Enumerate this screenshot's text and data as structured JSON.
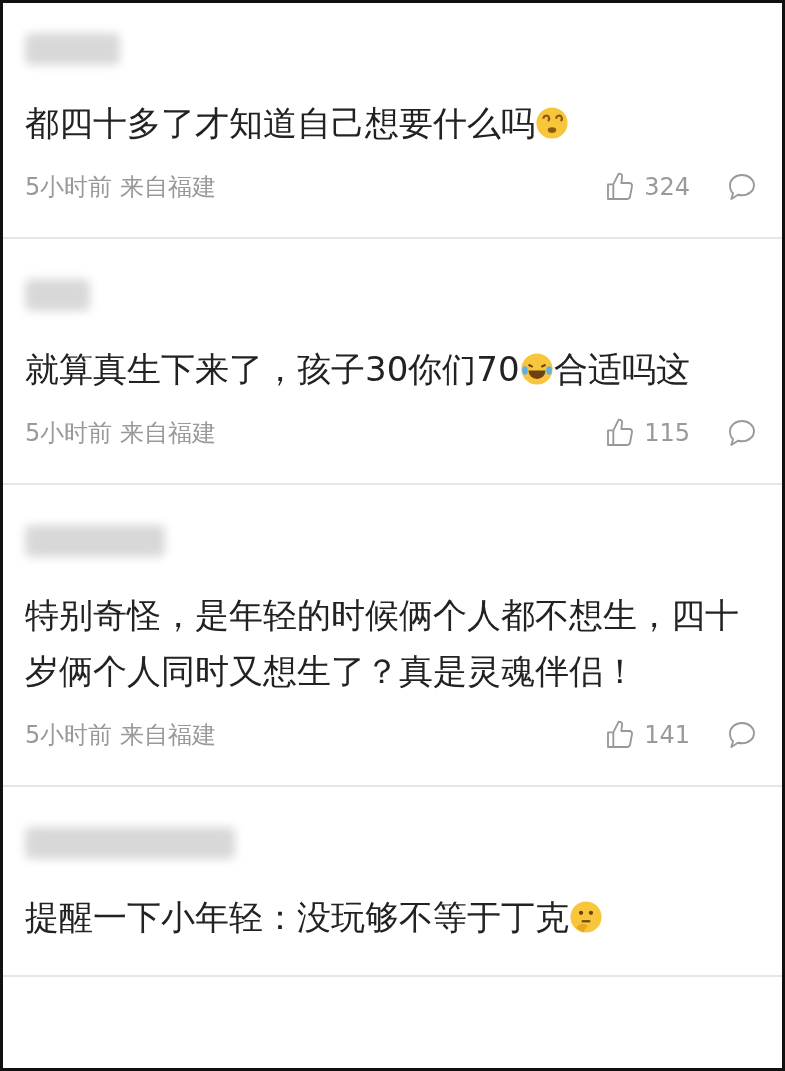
{
  "comments": [
    {
      "segments": [
        {
          "kind": "text",
          "text": "都四十多了才知道自己想要什么吗"
        },
        {
          "kind": "dizzy"
        }
      ],
      "time": "5小时前",
      "location": "来自福建",
      "likes": "324"
    },
    {
      "segments": [
        {
          "kind": "text",
          "text": "就算真生下来了，孩子30你们70"
        },
        {
          "kind": "laugh"
        },
        {
          "kind": "text",
          "text": "合适吗这"
        }
      ],
      "time": "5小时前",
      "location": "来自福建",
      "likes": "115"
    },
    {
      "segments": [
        {
          "kind": "text",
          "text": "特别奇怪，是年轻的时候俩个人都不想生，四十岁俩个人同时又想生了？真是灵魂伴侣！"
        }
      ],
      "time": "5小时前",
      "location": "来自福建",
      "likes": "141"
    },
    {
      "segments": [
        {
          "kind": "text",
          "text": "提醒一下小年轻：没玩够不等于丁克"
        },
        {
          "kind": "thinking"
        }
      ]
    }
  ]
}
